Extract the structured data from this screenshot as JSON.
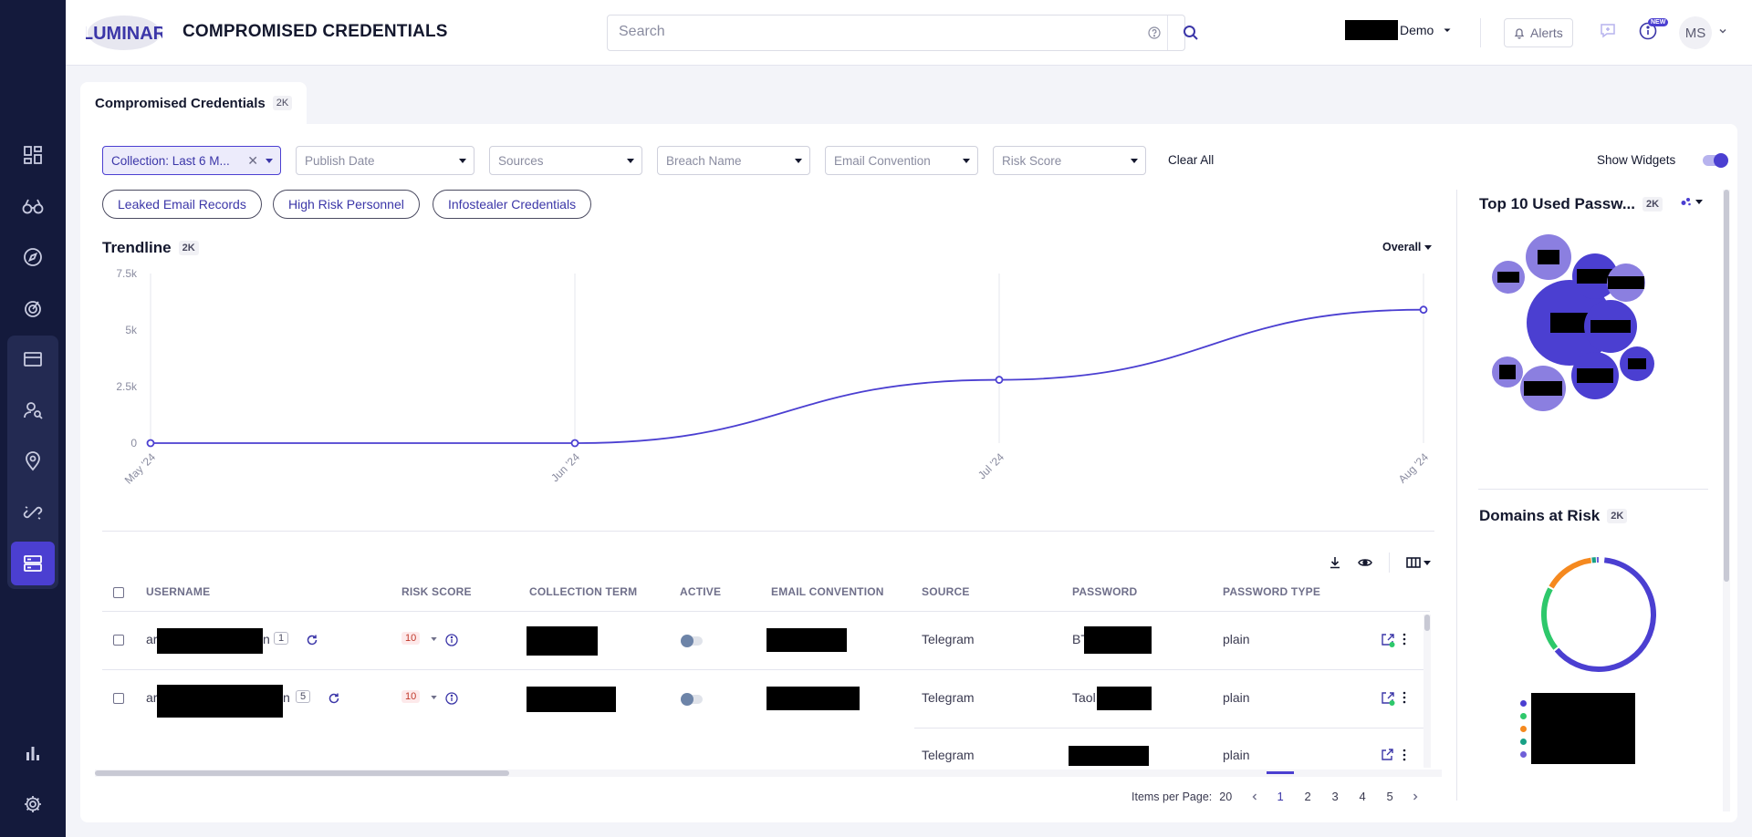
{
  "header": {
    "logo_text": "LUMINAR",
    "title": "COMPROMISED CREDENTIALS",
    "search_placeholder": "Search",
    "tenant_label": "Demo",
    "alerts_label": "Alerts",
    "new_badge": "NEW",
    "avatar_initials": "MS"
  },
  "tabs": [
    {
      "label": "Compromised Credentials",
      "count": "2K"
    }
  ],
  "filters": [
    {
      "label": "Collection: Last 6 M...",
      "active": true
    },
    {
      "label": "Publish Date"
    },
    {
      "label": "Sources"
    },
    {
      "label": "Breach Name"
    },
    {
      "label": "Email Convention"
    },
    {
      "label": "Risk Score"
    }
  ],
  "clear_all_label": "Clear All",
  "show_widgets_label": "Show Widgets",
  "quick_filters": [
    "Leaked Email Records",
    "High Risk Personnel",
    "Infostealer Credentials"
  ],
  "trendline": {
    "title": "Trendline",
    "count": "2K",
    "view_selector": "Overall"
  },
  "chart_data": {
    "type": "line",
    "x": [
      "May '24",
      "Jun '24",
      "Jul '24",
      "Aug '24"
    ],
    "y_ticks": [
      "0",
      "2.5k",
      "5k",
      "7.5k"
    ],
    "values": [
      0,
      0,
      2800,
      5900
    ],
    "ylim": [
      0,
      7500
    ],
    "color": "#4b3fd1",
    "grid": "vertical"
  },
  "table": {
    "columns": [
      "USERNAME",
      "RISK SCORE",
      "COLLECTION TERM",
      "ACTIVE",
      "EMAIL CONVENTION",
      "SOURCE",
      "PASSWORD",
      "PASSWORD TYPE"
    ],
    "rows": [
      {
        "username_prefix": "ar",
        "username_suffix": "n",
        "count": "1",
        "risk": "10",
        "source": "Telegram",
        "password_prefix": "BT",
        "password_type": "plain"
      },
      {
        "username_prefix": "ar",
        "username_suffix": "n",
        "count": "5",
        "risk": "10",
        "source": "Telegram",
        "password_prefix": "Taol",
        "password_type": "plain"
      },
      {
        "username_prefix": "",
        "username_suffix": "",
        "count": "",
        "risk": "",
        "source": "Telegram",
        "password_prefix": "",
        "password_type": "plain"
      }
    ]
  },
  "pagination": {
    "items_per_page_label": "Items per Page:",
    "items_per_page": "20",
    "pages": [
      "1",
      "2",
      "3",
      "4",
      "5"
    ],
    "current": "1"
  },
  "widgets": {
    "passwords": {
      "title": "Top 10 Used Passw...",
      "count": "2K"
    },
    "domains": {
      "title": "Domains at Risk",
      "count": "2K"
    }
  },
  "colors": {
    "accent": "#4b3fd1",
    "sidebar": "#141a3c",
    "bubble_light": "#8b7fe0",
    "donut_green": "#2ec86b",
    "donut_orange": "#f5891f",
    "donut_teal": "#17a085"
  }
}
